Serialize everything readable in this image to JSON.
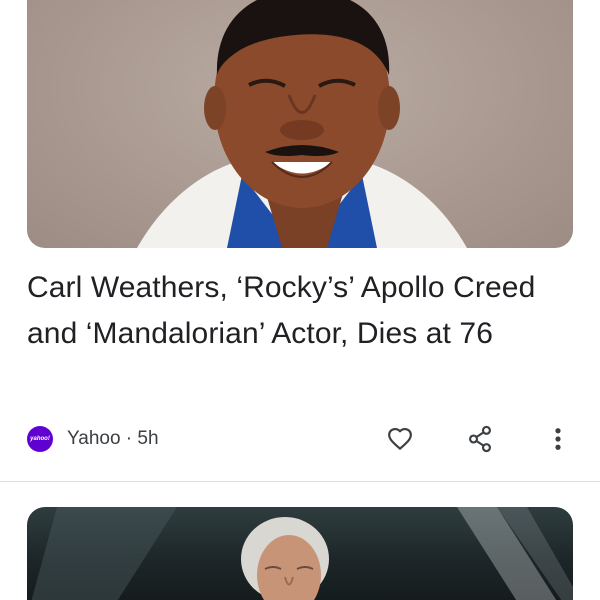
{
  "feed": {
    "articles": [
      {
        "headline": "Carl Weathers, ‘Rocky’s’ Apollo Creed and ‘Mandalorian’ Actor, Dies at 76",
        "source": {
          "name": "Yahoo",
          "logo_text": "yahoo!",
          "logo_color": "#6001d2"
        },
        "time_ago": "5h",
        "separator": " · ",
        "actions": {
          "like_icon": "heart-outline-icon",
          "share_icon": "share-icon",
          "more_icon": "more-vert-icon"
        }
      }
    ]
  }
}
